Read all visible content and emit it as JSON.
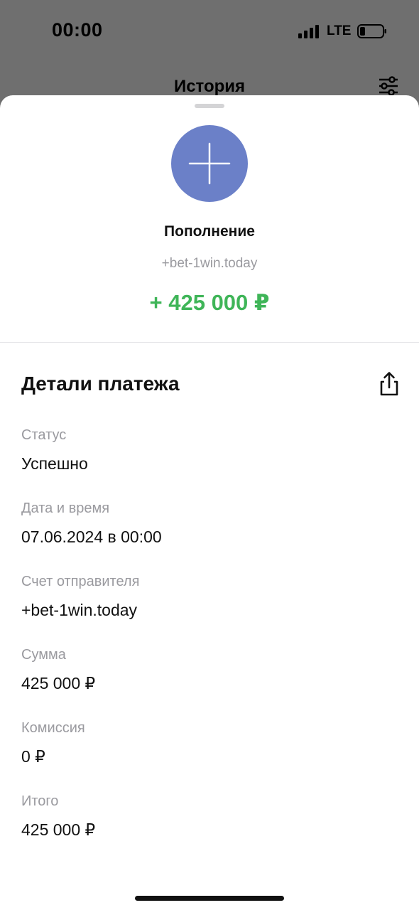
{
  "status_bar": {
    "time": "00:00",
    "network": "LTE",
    "icons": [
      "signal-icon",
      "battery-icon"
    ]
  },
  "header": {
    "title": "История",
    "filter_icon": "sliders-icon"
  },
  "operation": {
    "icon": "plus-icon",
    "icon_color": "#6b80c8",
    "title": "Пополнение",
    "source": "+bet-1win.today",
    "amount": "+ 425 000 ₽",
    "amount_color": "#3fb558"
  },
  "details": {
    "heading": "Детали платежа",
    "share_icon": "share-icon",
    "items": [
      {
        "label": "Статус",
        "value": "Успешно"
      },
      {
        "label": "Дата и время",
        "value": "07.06.2024 в 00:00"
      },
      {
        "label": "Счет отправителя",
        "value": "+bet-1win.today"
      },
      {
        "label": "Сумма",
        "value": "425 000 ₽"
      },
      {
        "label": "Комиссия",
        "value": "0 ₽"
      },
      {
        "label": "Итого",
        "value": "425 000 ₽"
      }
    ]
  }
}
